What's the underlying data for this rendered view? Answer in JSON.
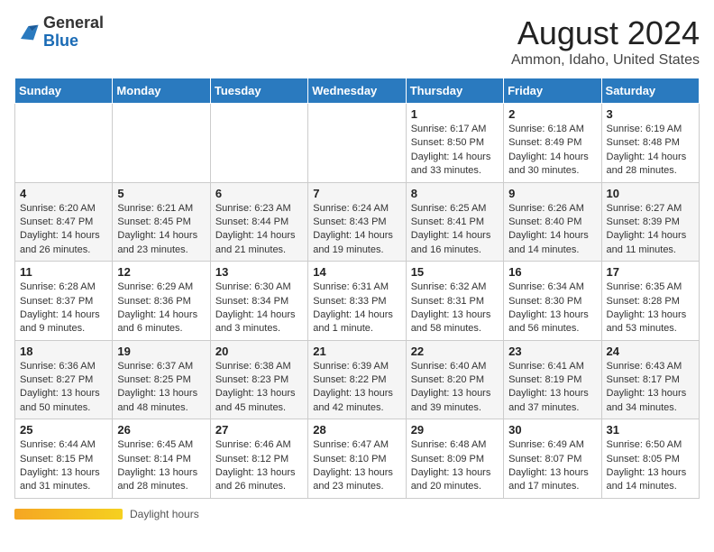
{
  "logo": {
    "general": "General",
    "blue": "Blue"
  },
  "title": "August 2024",
  "subtitle": "Ammon, Idaho, United States",
  "days_of_week": [
    "Sunday",
    "Monday",
    "Tuesday",
    "Wednesday",
    "Thursday",
    "Friday",
    "Saturday"
  ],
  "footer": {
    "daylight_label": "Daylight hours"
  },
  "weeks": [
    [
      {
        "day": "",
        "info": ""
      },
      {
        "day": "",
        "info": ""
      },
      {
        "day": "",
        "info": ""
      },
      {
        "day": "",
        "info": ""
      },
      {
        "day": "1",
        "info": "Sunrise: 6:17 AM\nSunset: 8:50 PM\nDaylight: 14 hours and 33 minutes."
      },
      {
        "day": "2",
        "info": "Sunrise: 6:18 AM\nSunset: 8:49 PM\nDaylight: 14 hours and 30 minutes."
      },
      {
        "day": "3",
        "info": "Sunrise: 6:19 AM\nSunset: 8:48 PM\nDaylight: 14 hours and 28 minutes."
      }
    ],
    [
      {
        "day": "4",
        "info": "Sunrise: 6:20 AM\nSunset: 8:47 PM\nDaylight: 14 hours and 26 minutes."
      },
      {
        "day": "5",
        "info": "Sunrise: 6:21 AM\nSunset: 8:45 PM\nDaylight: 14 hours and 23 minutes."
      },
      {
        "day": "6",
        "info": "Sunrise: 6:23 AM\nSunset: 8:44 PM\nDaylight: 14 hours and 21 minutes."
      },
      {
        "day": "7",
        "info": "Sunrise: 6:24 AM\nSunset: 8:43 PM\nDaylight: 14 hours and 19 minutes."
      },
      {
        "day": "8",
        "info": "Sunrise: 6:25 AM\nSunset: 8:41 PM\nDaylight: 14 hours and 16 minutes."
      },
      {
        "day": "9",
        "info": "Sunrise: 6:26 AM\nSunset: 8:40 PM\nDaylight: 14 hours and 14 minutes."
      },
      {
        "day": "10",
        "info": "Sunrise: 6:27 AM\nSunset: 8:39 PM\nDaylight: 14 hours and 11 minutes."
      }
    ],
    [
      {
        "day": "11",
        "info": "Sunrise: 6:28 AM\nSunset: 8:37 PM\nDaylight: 14 hours and 9 minutes."
      },
      {
        "day": "12",
        "info": "Sunrise: 6:29 AM\nSunset: 8:36 PM\nDaylight: 14 hours and 6 minutes."
      },
      {
        "day": "13",
        "info": "Sunrise: 6:30 AM\nSunset: 8:34 PM\nDaylight: 14 hours and 3 minutes."
      },
      {
        "day": "14",
        "info": "Sunrise: 6:31 AM\nSunset: 8:33 PM\nDaylight: 14 hours and 1 minute."
      },
      {
        "day": "15",
        "info": "Sunrise: 6:32 AM\nSunset: 8:31 PM\nDaylight: 13 hours and 58 minutes."
      },
      {
        "day": "16",
        "info": "Sunrise: 6:34 AM\nSunset: 8:30 PM\nDaylight: 13 hours and 56 minutes."
      },
      {
        "day": "17",
        "info": "Sunrise: 6:35 AM\nSunset: 8:28 PM\nDaylight: 13 hours and 53 minutes."
      }
    ],
    [
      {
        "day": "18",
        "info": "Sunrise: 6:36 AM\nSunset: 8:27 PM\nDaylight: 13 hours and 50 minutes."
      },
      {
        "day": "19",
        "info": "Sunrise: 6:37 AM\nSunset: 8:25 PM\nDaylight: 13 hours and 48 minutes."
      },
      {
        "day": "20",
        "info": "Sunrise: 6:38 AM\nSunset: 8:23 PM\nDaylight: 13 hours and 45 minutes."
      },
      {
        "day": "21",
        "info": "Sunrise: 6:39 AM\nSunset: 8:22 PM\nDaylight: 13 hours and 42 minutes."
      },
      {
        "day": "22",
        "info": "Sunrise: 6:40 AM\nSunset: 8:20 PM\nDaylight: 13 hours and 39 minutes."
      },
      {
        "day": "23",
        "info": "Sunrise: 6:41 AM\nSunset: 8:19 PM\nDaylight: 13 hours and 37 minutes."
      },
      {
        "day": "24",
        "info": "Sunrise: 6:43 AM\nSunset: 8:17 PM\nDaylight: 13 hours and 34 minutes."
      }
    ],
    [
      {
        "day": "25",
        "info": "Sunrise: 6:44 AM\nSunset: 8:15 PM\nDaylight: 13 hours and 31 minutes."
      },
      {
        "day": "26",
        "info": "Sunrise: 6:45 AM\nSunset: 8:14 PM\nDaylight: 13 hours and 28 minutes."
      },
      {
        "day": "27",
        "info": "Sunrise: 6:46 AM\nSunset: 8:12 PM\nDaylight: 13 hours and 26 minutes."
      },
      {
        "day": "28",
        "info": "Sunrise: 6:47 AM\nSunset: 8:10 PM\nDaylight: 13 hours and 23 minutes."
      },
      {
        "day": "29",
        "info": "Sunrise: 6:48 AM\nSunset: 8:09 PM\nDaylight: 13 hours and 20 minutes."
      },
      {
        "day": "30",
        "info": "Sunrise: 6:49 AM\nSunset: 8:07 PM\nDaylight: 13 hours and 17 minutes."
      },
      {
        "day": "31",
        "info": "Sunrise: 6:50 AM\nSunset: 8:05 PM\nDaylight: 13 hours and 14 minutes."
      }
    ]
  ]
}
